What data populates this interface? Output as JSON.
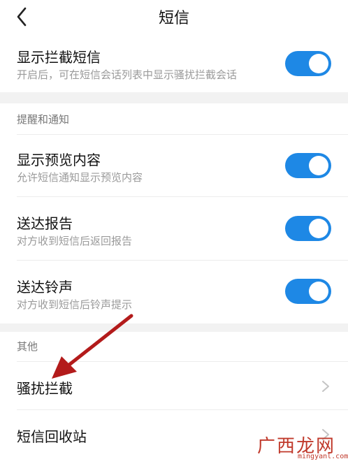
{
  "header": {
    "title": "短信",
    "back_icon": "chevron-left-icon"
  },
  "rows": {
    "blocked_sms": {
      "title": "显示拦截短信",
      "subtitle": "开启后，可在短信会话列表中显示骚扰拦截会话",
      "enabled": true
    },
    "preview": {
      "title": "显示预览内容",
      "subtitle": "允许短信通知显示预览内容",
      "enabled": true
    },
    "delivery_report": {
      "title": "送达报告",
      "subtitle": "对方收到短信后返回报告",
      "enabled": true
    },
    "delivery_tone": {
      "title": "送达铃声",
      "subtitle": "对方收到短信后铃声提示",
      "enabled": true
    },
    "harassment_block": {
      "title": "骚扰拦截"
    },
    "recycle_bin": {
      "title": "短信回收站"
    }
  },
  "sections": {
    "notifications": "提醒和通知",
    "other": "其他"
  },
  "colors": {
    "toggle_on": "#1e88e5",
    "annotation_arrow": "#b31b1b",
    "watermark": "#c0392b"
  },
  "watermark": {
    "chinese": "广西龙网",
    "latin": "mingyanl.com"
  }
}
